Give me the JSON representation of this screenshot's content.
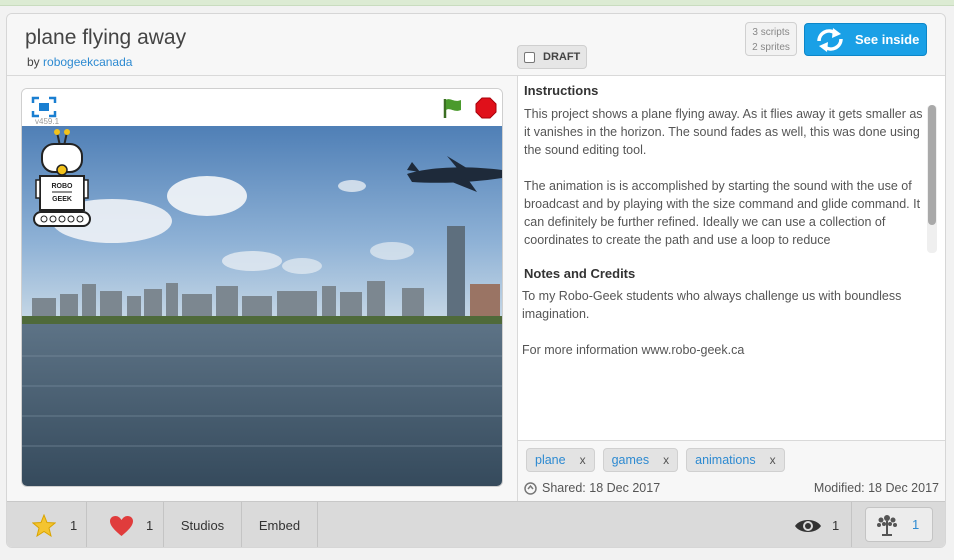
{
  "project": {
    "title": "plane flying away",
    "by_prefix": "by",
    "author": "robogeekcanada",
    "draft_label": "DRAFT",
    "scripts_count": "3 scripts",
    "sprites_count": "2 sprites",
    "see_inside_label": "See inside"
  },
  "player": {
    "version": "v459.1",
    "robo_label_1": "ROBO",
    "robo_label_2": "GEEK"
  },
  "instructions": {
    "title": "Instructions",
    "text": "This project shows a plane flying away. As it flies away it gets smaller as it vanishes in the horizon. The sound fades as well, this was done using the sound editing tool.\n\nThe animation is is accomplished by starting the sound with the use of broadcast and by playing with the size command and glide command. It can definitely be further refined. Ideally we can use a collection of coordinates to create the path and use a loop to reduce"
  },
  "notes": {
    "title": "Notes and Credits",
    "text": "To my Robo-Geek students who always challenge us with boundless imagination.\n\nFor more information www.robo-geek.ca"
  },
  "tags": [
    {
      "label": "plane",
      "remove": "x"
    },
    {
      "label": "games",
      "remove": "x"
    },
    {
      "label": "animations",
      "remove": "x"
    }
  ],
  "dates": {
    "shared": "Shared: 18 Dec 2017",
    "modified": "Modified: 18 Dec 2017"
  },
  "footer": {
    "favorites": "1",
    "loves": "1",
    "studios_label": "Studios",
    "embed_label": "Embed",
    "views": "1",
    "remixes": "1"
  },
  "colors": {
    "accent": "#1aa0e6",
    "link": "#2d8ad1",
    "star": "#f4c430",
    "heart": "#e03c3c",
    "flag": "#4a9a2c",
    "stop": "#e0101a"
  }
}
